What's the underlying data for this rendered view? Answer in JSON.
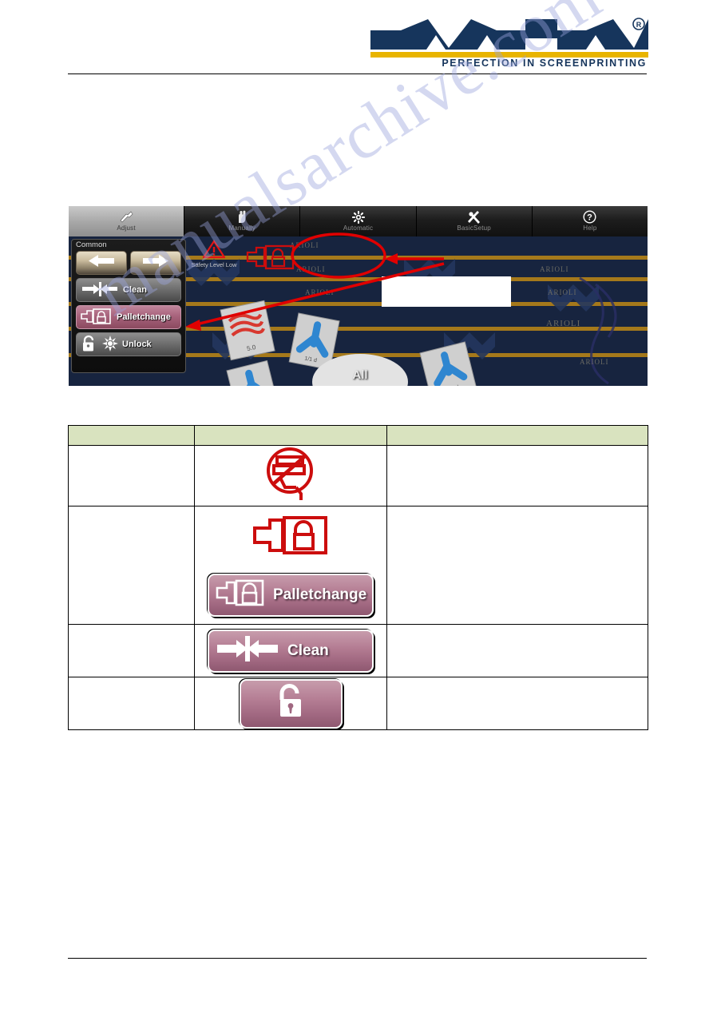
{
  "brand": {
    "logo_text": "MHM",
    "registered_mark": "®",
    "tagline": "PERFECTION IN SCREENPRINTING",
    "navy": "#16355c",
    "gold": "#e8b400"
  },
  "watermark": {
    "text": "manualsarchive.com",
    "color": "#9aa4dd"
  },
  "screenshot": {
    "tabs": [
      {
        "label": "Adjust",
        "icon": "wrench-icon",
        "active": true
      },
      {
        "label": "Manually",
        "icon": "hand-icon",
        "active": false
      },
      {
        "label": "Automatic",
        "icon": "gear-icon",
        "active": false
      },
      {
        "label": "BasicSetup",
        "icon": "tools-icon",
        "active": false
      },
      {
        "label": "Help",
        "icon": "question-icon",
        "active": false
      }
    ],
    "panel": {
      "title": "Common",
      "buttons": [
        {
          "label": "",
          "icon": "arrow-left-icon",
          "style": "arrow"
        },
        {
          "label": "",
          "icon": "arrow-right-icon",
          "style": "arrow"
        },
        {
          "label": "Clean",
          "icon": "clean-icon",
          "style": "grey"
        },
        {
          "label": "Palletchange",
          "icon": "palletchange-icon",
          "style": "pink"
        },
        {
          "label": "Unlock",
          "icon": "unlock-icon",
          "style": "grey"
        }
      ]
    },
    "status": {
      "warning_icon": "warning-triangle-icon",
      "text": "Safety Level Low"
    },
    "machine_label": "ARIOLI",
    "all_button_label": "All",
    "highlighted_icon": "palletchange-status-icon",
    "callout_text": "",
    "annotation_color": "#e00000"
  },
  "table": {
    "header": {
      "col1": "",
      "col2": "",
      "col3": ""
    },
    "rows": [
      {
        "col1": "",
        "col2_graphics": [
          {
            "type": "icon",
            "name": "no-squeegee-prohibited-icon"
          }
        ],
        "col3": ""
      },
      {
        "col1": "",
        "col2_graphics": [
          {
            "type": "icon",
            "name": "palletchange-outline-icon"
          },
          {
            "type": "button",
            "name": "palletchange-button",
            "label": "Palletchange",
            "icon": "palletchange-icon"
          }
        ],
        "col3": ""
      },
      {
        "col1": "",
        "col2_graphics": [
          {
            "type": "button",
            "name": "clean-button",
            "label": "Clean",
            "icon": "clean-icon"
          }
        ],
        "col3": ""
      },
      {
        "col1": "",
        "col2_graphics": [
          {
            "type": "button",
            "name": "unlock-button",
            "label": "",
            "icon": "open-padlock-icon"
          }
        ],
        "col3": ""
      }
    ]
  }
}
